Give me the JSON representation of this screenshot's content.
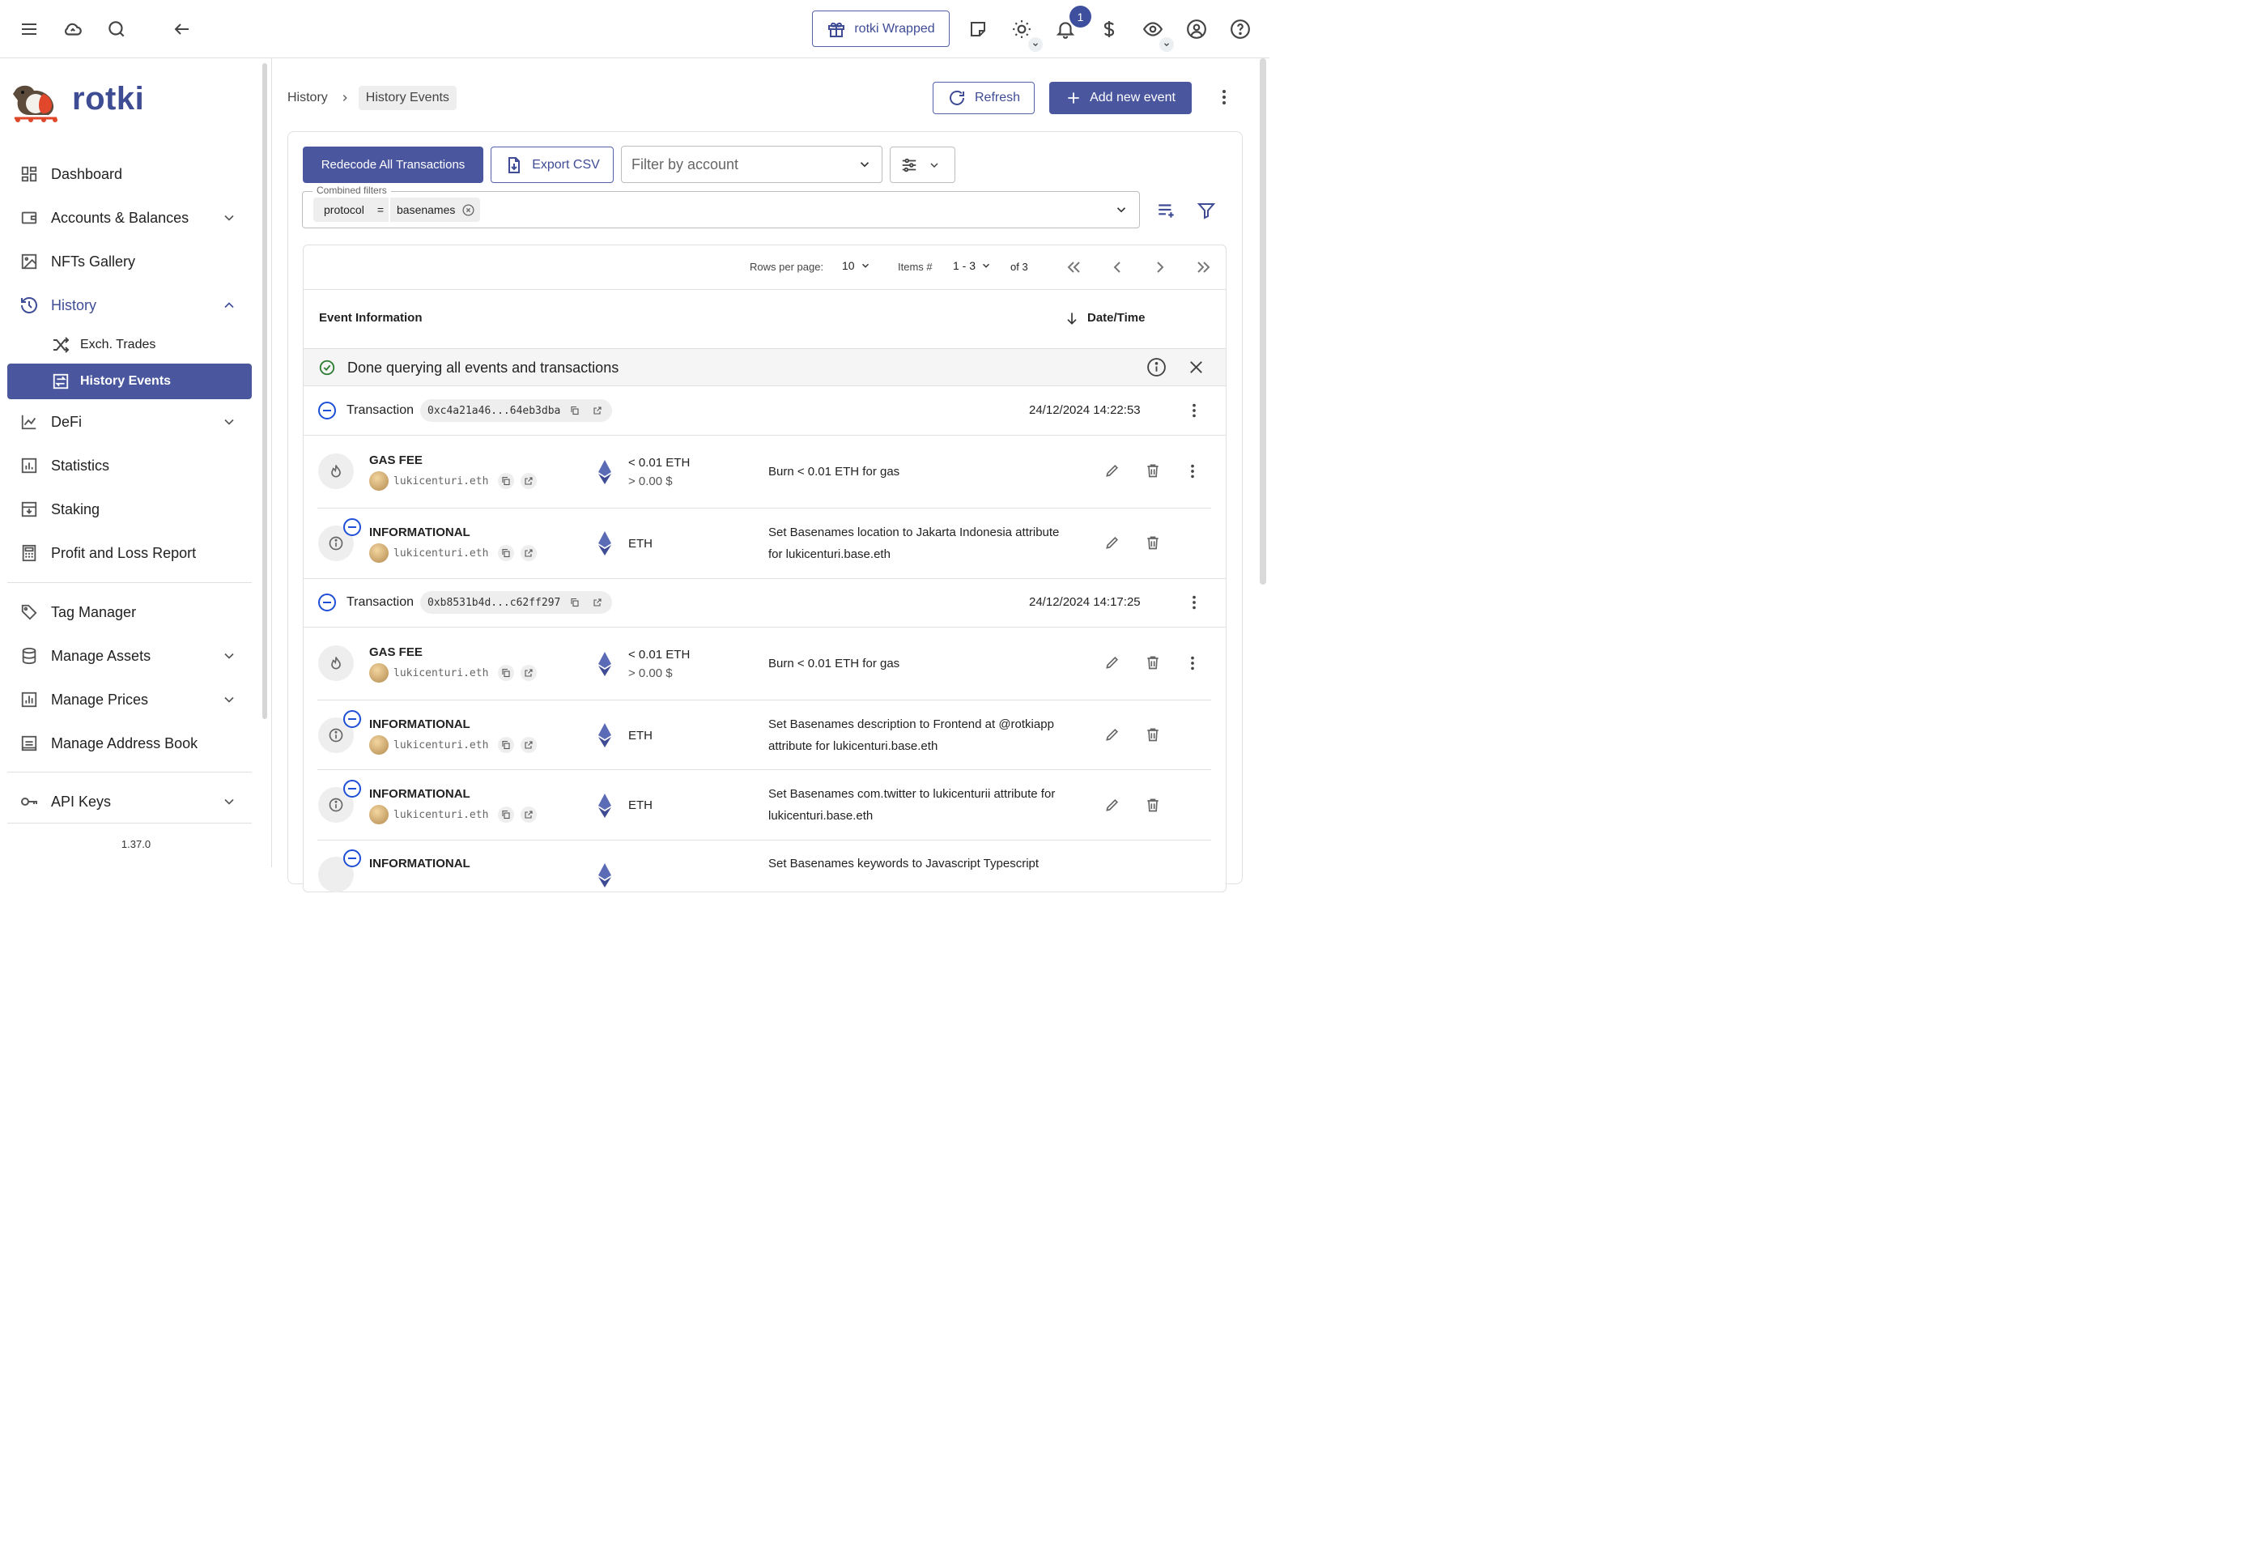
{
  "topbar": {
    "wrapped_label": "rotki Wrapped",
    "notification_count": "1"
  },
  "sidebar": {
    "brand": "rotki",
    "items": [
      {
        "label": "Dashboard",
        "icon": "dashboard-icon"
      },
      {
        "label": "Accounts & Balances",
        "icon": "wallet-icon"
      },
      {
        "label": "NFTs Gallery",
        "icon": "image-icon"
      },
      {
        "label": "History",
        "icon": "history-icon"
      },
      {
        "label": "Exch. Trades",
        "icon": "shuffle-icon"
      },
      {
        "label": "History Events",
        "icon": "exchange-icon"
      },
      {
        "label": "DeFi",
        "icon": "chart-line-icon"
      },
      {
        "label": "Statistics",
        "icon": "bar-chart-icon"
      },
      {
        "label": "Staking",
        "icon": "inbox-icon"
      },
      {
        "label": "Profit and Loss Report",
        "icon": "calculator-icon"
      },
      {
        "label": "Tag Manager",
        "icon": "tag-icon"
      },
      {
        "label": "Manage Assets",
        "icon": "database-icon"
      },
      {
        "label": "Manage Prices",
        "icon": "price-chart-icon"
      },
      {
        "label": "Manage Address Book",
        "icon": "address-book-icon"
      },
      {
        "label": "API Keys",
        "icon": "key-icon"
      }
    ],
    "version": "1.37.0"
  },
  "breadcrumb": {
    "parent": "History",
    "current": "History Events"
  },
  "header_actions": {
    "refresh": "Refresh",
    "add_event": "Add new event"
  },
  "toolbar": {
    "redecode": "Redecode All Transactions",
    "export_csv": "Export CSV",
    "filter_account_placeholder": "Filter by account",
    "combined_filters_label": "Combined filters",
    "filter_key": "protocol",
    "filter_op": "=",
    "filter_value": "basenames"
  },
  "pagination": {
    "rows_label": "Rows per page:",
    "rows_value": "10",
    "items_label": "Items #",
    "items_range": "1 - 3",
    "of_total": "of 3"
  },
  "table": {
    "col_event": "Event Information",
    "col_date": "Date/Time",
    "status_message": "Done querying all events and transactions"
  },
  "transactions": [
    {
      "label": "Transaction",
      "hash": "0xc4a21a46...64eb3dba",
      "datetime": "24/12/2024 14:22:53",
      "events": [
        {
          "type": "GAS FEE",
          "account": "lukicenturi.eth",
          "amount": "< 0.01 ETH",
          "value": "> 0.00 $",
          "desc1": "Burn < 0.01 ETH for gas",
          "desc2": ""
        },
        {
          "type": "INFORMATIONAL",
          "account": "lukicenturi.eth",
          "amount": "ETH",
          "value": "",
          "desc1": "Set Basenames location to Jakarta Indonesia attribute",
          "desc2": "for lukicenturi.base.eth"
        }
      ]
    },
    {
      "label": "Transaction",
      "hash": "0xb8531b4d...c62ff297",
      "datetime": "24/12/2024 14:17:25",
      "events": [
        {
          "type": "GAS FEE",
          "account": "lukicenturi.eth",
          "amount": "< 0.01 ETH",
          "value": "> 0.00 $",
          "desc1": "Burn < 0.01 ETH for gas",
          "desc2": ""
        },
        {
          "type": "INFORMATIONAL",
          "account": "lukicenturi.eth",
          "amount": "ETH",
          "value": "",
          "desc1": "Set Basenames description to Frontend at @rotkiapp",
          "desc2": "attribute for lukicenturi.base.eth"
        },
        {
          "type": "INFORMATIONAL",
          "account": "lukicenturi.eth",
          "amount": "ETH",
          "value": "",
          "desc1": "Set Basenames com.twitter to lukicenturii attribute for",
          "desc2": "lukicenturi.base.eth"
        },
        {
          "type": "INFORMATIONAL",
          "account": "",
          "amount": "",
          "value": "",
          "desc1": "Set Basenames keywords to Javascript Typescript",
          "desc2": ""
        }
      ]
    }
  ],
  "colors": {
    "primary": "#4a579f",
    "accent_blue": "#1e4fd6",
    "success": "#2e7d32"
  }
}
